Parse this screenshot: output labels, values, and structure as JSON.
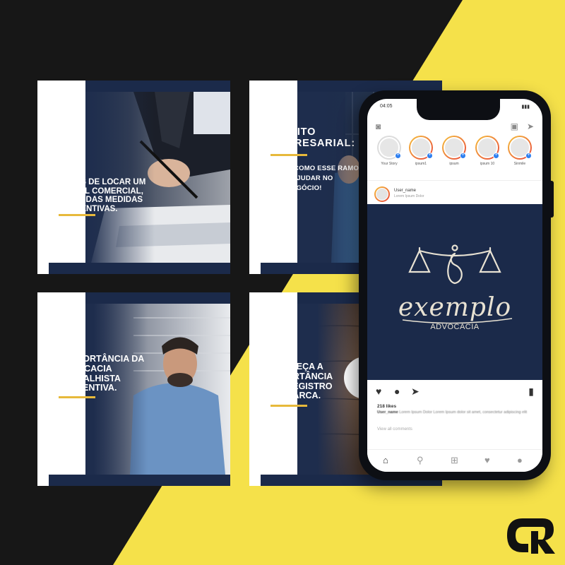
{
  "colors": {
    "background_dark": "#171717",
    "accent_yellow": "#f5e14a",
    "navy": "#1b2a4a",
    "gold": "#e7b93b"
  },
  "posts": [
    {
      "title_lines": [
        "ANTES DE LOCAR UM",
        "IMÓVEL COMERCIAL,",
        "SAIBA DAS MEDIDAS",
        "PREVENTIVAS."
      ],
      "photo": "businessman-signing-document"
    },
    {
      "title_lines": [
        "DIREITO",
        "EMPRESARIAL:"
      ],
      "subtitle_lines": [
        "SAIBA COMO ESSE RAMO",
        "PODE AJUDAR NO",
        "SEU NEGÓCIO!"
      ],
      "photo": "businesswoman-office"
    },
    {
      "title_lines": [
        "A IMPORTÂNCIA DA",
        "ADVOCACIA",
        "TRABALHISTA",
        "PREVENTIVA."
      ],
      "photo": "thoughtful-man"
    },
    {
      "title_lines": [
        "CONHEÇA A",
        "IMPORTÂNCIA",
        "DO REGISTRO",
        "DA MARCA."
      ],
      "photo": "wood-texture"
    }
  ],
  "phone": {
    "status_time": "04:05",
    "stories": [
      {
        "label": "Your Story"
      },
      {
        "label": "ipsum1"
      },
      {
        "label": "ipsum"
      },
      {
        "label": "ipsum 10"
      },
      {
        "label": "Sinmile"
      }
    ],
    "post": {
      "username": "User_name",
      "location": "Lorem Ipsum Dolor",
      "logo_word": "exemplo",
      "logo_sub": "ADVOCACIA",
      "likes": "218 likes",
      "caption_user": "User_name",
      "caption_text": "Lorem Ipsum Dolor Lorem Ipsum dolor sit amet, consectetur adipiscing elit",
      "view_comments": "View all comments"
    }
  },
  "icons": {
    "camera": "camera-icon",
    "send": "send-icon",
    "heart": "heart-icon",
    "comment": "comment-icon",
    "bookmark": "bookmark-icon",
    "home": "home-icon",
    "search": "search-icon",
    "add": "add-icon",
    "profile": "profile-icon"
  }
}
